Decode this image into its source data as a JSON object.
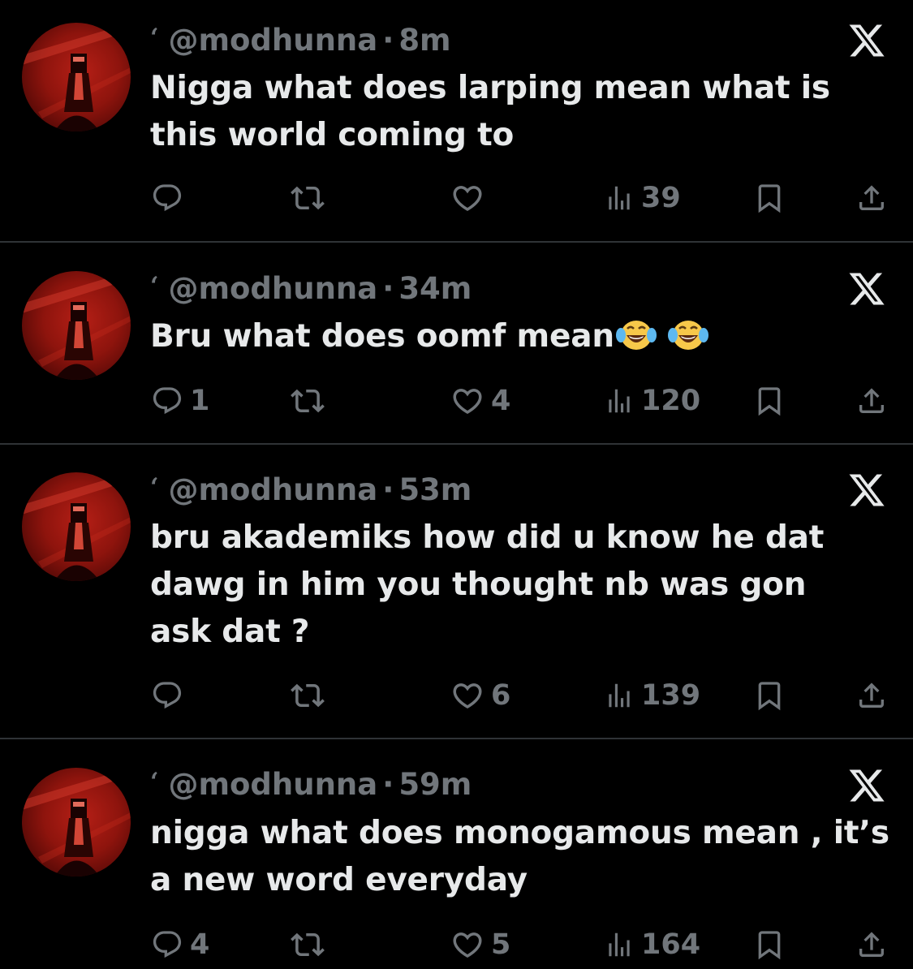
{
  "tweets": [
    {
      "handle": "@modhunna",
      "quote_mark": "‘",
      "sep": "·",
      "time": "8m",
      "text": "Nigga what does larping mean what is this world coming to",
      "replies": "",
      "retweets": "",
      "likes": "",
      "views": "39"
    },
    {
      "handle": "@modhunna",
      "quote_mark": "‘",
      "sep": "·",
      "time": "34m",
      "text": "Bru what does oomf mean",
      "emojis": [
        "face-with-tears-of-joy",
        "face-with-tears-of-joy"
      ],
      "replies": "1",
      "retweets": "",
      "likes": "4",
      "views": "120"
    },
    {
      "handle": "@modhunna",
      "quote_mark": "‘",
      "sep": "·",
      "time": "53m",
      "text": "bru akademiks how did u know he dat dawg in him you thought nb was gon ask dat ?",
      "replies": "",
      "retweets": "",
      "likes": "6",
      "views": "139"
    },
    {
      "handle": "@modhunna",
      "quote_mark": "‘",
      "sep": "·",
      "time": "59m",
      "text": "nigga what does monogamous mean , it’s a new word everyday",
      "replies": "4",
      "retweets": "",
      "likes": "5",
      "views": "164"
    }
  ],
  "icons": {
    "reply": "reply-icon",
    "retweet": "retweet-icon",
    "like": "heart-icon",
    "views": "views-icon",
    "bookmark": "bookmark-icon",
    "share": "share-icon",
    "logo": "x-logo-icon"
  },
  "colors": {
    "background": "#000000",
    "text": "#e7e9ea",
    "muted": "#71767b",
    "divider": "#2f3336",
    "avatar": "#a8190f"
  }
}
